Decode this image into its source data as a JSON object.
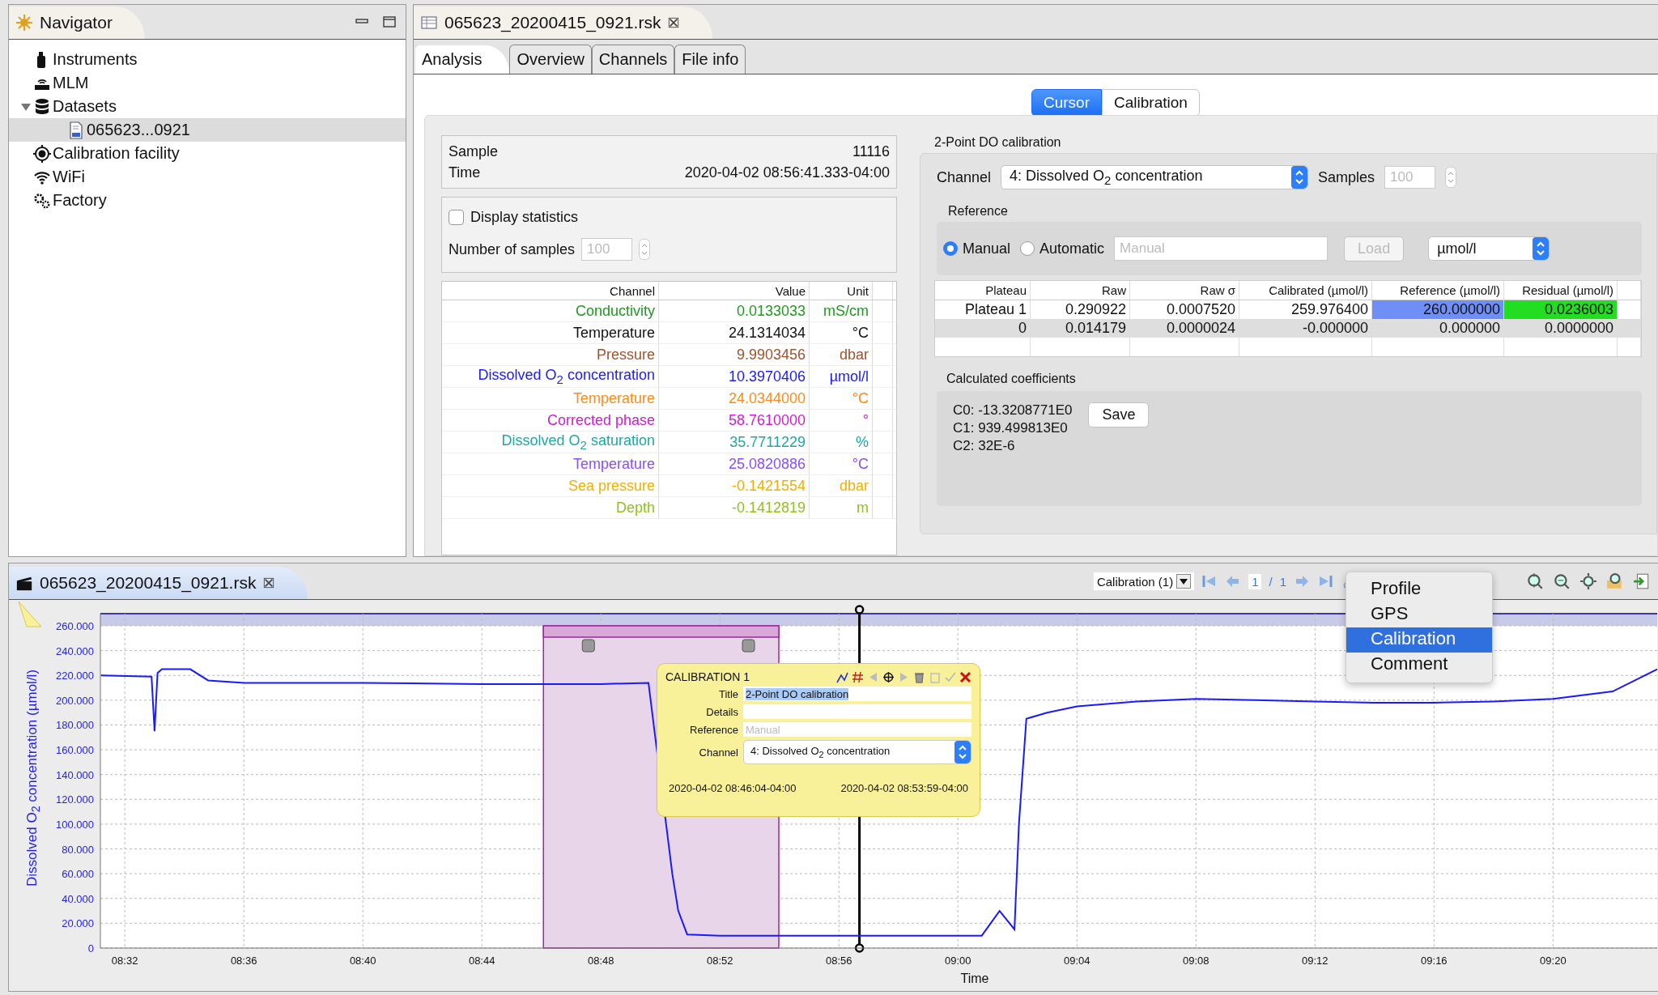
{
  "navigator": {
    "title": "Navigator",
    "items": [
      {
        "label": "Instruments",
        "kind": "instruments",
        "selected": false
      },
      {
        "label": "MLM",
        "kind": "mlm",
        "selected": false
      },
      {
        "label": "Datasets",
        "kind": "datasets",
        "selected": false,
        "expanded": true,
        "children": [
          {
            "label": "065623...0921",
            "kind": "file",
            "selected": true
          }
        ]
      },
      {
        "label": "Calibration facility",
        "kind": "facility",
        "selected": false
      },
      {
        "label": "WiFi",
        "kind": "wifi",
        "selected": false
      },
      {
        "label": "Factory",
        "kind": "factory",
        "selected": false
      }
    ]
  },
  "editor": {
    "tab": "065623_20200415_0921.rsk",
    "subtabs": [
      {
        "label": "Analysis",
        "selected": true
      },
      {
        "label": "Overview",
        "selected": false
      },
      {
        "label": "Channels",
        "selected": false
      },
      {
        "label": "File info",
        "selected": false
      }
    ],
    "modes": [
      {
        "label": "Cursor",
        "selected": true
      },
      {
        "label": "Calibration",
        "selected": false
      }
    ],
    "cursor": {
      "sample_label": "Sample",
      "sample": "11116",
      "time_label": "Time",
      "time": "2020-04-02 08:56:41.333-04:00"
    },
    "statistics": {
      "label": "Display statistics",
      "checked": false,
      "samples_label": "Number of samples",
      "samples": "100",
      "disabled": true
    },
    "channels": {
      "columns": [
        "Channel",
        "Value",
        "Unit"
      ],
      "rows": [
        {
          "name": "Conductivity",
          "value": "0.0133033",
          "unit": "mS/cm",
          "color": "#1e9a1e"
        },
        {
          "name": "Temperature",
          "value": "24.1314034",
          "unit": "°C",
          "color": "#111111"
        },
        {
          "name": "Pressure",
          "value": "9.9903456",
          "unit": "dbar",
          "color": "#a0522d"
        },
        {
          "name": "Dissolved O$_{2}$ concentration",
          "value": "10.3970406",
          "unit": "µmol/l",
          "color": "#1a1aff"
        },
        {
          "name": "Temperature",
          "value": "24.0344000",
          "unit": "°C",
          "color": "#ff8a1a"
        },
        {
          "name": "Corrected phase",
          "value": "58.7610000",
          "unit": "°",
          "color": "#d21ad2"
        },
        {
          "name": "Dissolved O$_{2}$ saturation",
          "value": "35.7711229",
          "unit": "%",
          "color": "#1fa6a6"
        },
        {
          "name": "Temperature",
          "value": "25.0820886",
          "unit": "°C",
          "color": "#8a4dff"
        },
        {
          "name": "Sea pressure",
          "value": "-0.1421554",
          "unit": "dbar",
          "color": "#f0b000"
        },
        {
          "name": "Depth",
          "value": "-0.1412819",
          "unit": "m",
          "color": "#8fc21a"
        }
      ]
    },
    "calibration": {
      "title": "2-Point DO calibration",
      "channel_label": "Channel",
      "channel": "4: Dissolved O$_{2}$ concentration",
      "samples_label": "Samples",
      "samples": "100",
      "samples_disabled": true,
      "reference_title": "Reference",
      "reference_modes": [
        {
          "label": "Manual",
          "selected": true
        },
        {
          "label": "Automatic",
          "selected": false
        }
      ],
      "reference_placeholder": "Manual",
      "load": "Load",
      "load_disabled": true,
      "unit": "µmol/l",
      "table": {
        "columns": [
          "Plateau",
          "Raw",
          "Raw σ",
          "Calibrated (µmol/l)",
          "Reference (µmol/l)",
          "Residual (µmol/l)"
        ],
        "rows": [
          {
            "selected": false,
            "cells": [
              {
                "text": "Plateau 1"
              },
              {
                "text": "0.290922"
              },
              {
                "text": "0.0007520"
              },
              {
                "text": "259.976400"
              },
              {
                "text": "260.000000",
                "color": "#6f8ff7"
              },
              {
                "text": "0.0236003",
                "color": "#22dd22"
              }
            ]
          },
          {
            "selected": true,
            "cells": [
              {
                "text": "0"
              },
              {
                "text": "0.014179"
              },
              {
                "text": "0.0000024"
              },
              {
                "text": "-0.000000"
              },
              {
                "text": "0.000000"
              },
              {
                "text": "0.0000000"
              }
            ]
          }
        ]
      },
      "coefficients_title": "Calculated coefficients",
      "coefficients": [
        "C0: -13.3208771E0",
        "C1: 939.499813E0",
        "C2: 32E-6"
      ],
      "save": "Save"
    }
  },
  "plot": {
    "tab": "065623_20200415_0921.rsk",
    "toolbar": {
      "annotation_type": "Calibration (1)",
      "page": "1",
      "separator": "/",
      "pages": "1"
    },
    "menu": [
      {
        "label": "Profile",
        "selected": false
      },
      {
        "label": "GPS",
        "selected": false
      },
      {
        "label": "Calibration",
        "selected": true
      },
      {
        "label": "Comment",
        "selected": false
      }
    ],
    "chart_data": {
      "type": "line",
      "xlabel": "Time",
      "ylabel": "Dissolved O$_{2}$ concentration (µmol/l)",
      "grid": true,
      "x": [
        511.2,
        512.9,
        513.0,
        513.1,
        513.25,
        514.2,
        514.8,
        516,
        520,
        524,
        528,
        529.6,
        530.4,
        530.6,
        530.9,
        532,
        536,
        540,
        540.8,
        541.4,
        541.9,
        542.05,
        542.3,
        543,
        544,
        546,
        548,
        550,
        552,
        554,
        556,
        558,
        560,
        562,
        563.5
      ],
      "values": [
        220,
        219,
        175,
        222,
        225,
        225,
        216,
        214,
        214,
        213,
        213,
        214,
        60,
        30,
        11,
        10,
        10,
        10,
        10,
        30,
        15,
        100,
        185,
        190,
        195,
        199,
        201,
        200,
        199,
        198,
        198,
        199,
        201,
        207,
        225
      ],
      "xlim": [
        511.18,
        563.5
      ],
      "ylim": [
        0,
        260
      ],
      "xticks": [
        {
          "value": 512,
          "label": "08:32"
        },
        {
          "value": 516,
          "label": "08:36"
        },
        {
          "value": 520,
          "label": "08:40"
        },
        {
          "value": 524,
          "label": "08:44"
        },
        {
          "value": 528,
          "label": "08:48"
        },
        {
          "value": 532,
          "label": "08:52"
        },
        {
          "value": 536,
          "label": "08:56"
        },
        {
          "value": 540,
          "label": "09:00"
        },
        {
          "value": 544,
          "label": "09:04"
        },
        {
          "value": 548,
          "label": "09:08"
        },
        {
          "value": 552,
          "label": "09:12"
        },
        {
          "value": 556,
          "label": "09:16"
        },
        {
          "value": 560,
          "label": "09:20"
        }
      ],
      "yticks": [
        {
          "value": 0,
          "label": "0"
        },
        {
          "value": 20,
          "label": "20.000"
        },
        {
          "value": 40,
          "label": "40.000"
        },
        {
          "value": 60,
          "label": "60.000"
        },
        {
          "value": 80,
          "label": "80.000"
        },
        {
          "value": 100,
          "label": "100.000"
        },
        {
          "value": 120,
          "label": "120.000"
        },
        {
          "value": 140,
          "label": "140.000"
        },
        {
          "value": 160,
          "label": "160.000"
        },
        {
          "value": 180,
          "label": "180.000"
        },
        {
          "value": 200,
          "label": "200.000"
        },
        {
          "value": 220,
          "label": "220.000"
        },
        {
          "value": 240,
          "label": "240.000"
        },
        {
          "value": 260,
          "label": "260.000"
        }
      ],
      "bands": [
        {
          "axis": "x",
          "from": 526.07,
          "to": 533.98
        }
      ],
      "ref_lines": [
        {
          "axis": "x",
          "value": 536.69
        }
      ]
    },
    "popup": {
      "title": "CALIBRATION 1",
      "fields": [
        {
          "label": "Title",
          "kind": "text",
          "value": "2-Point DO calibration"
        },
        {
          "label": "Details",
          "kind": "text"
        },
        {
          "label": "Reference",
          "kind": "text",
          "placeholder": "Manual"
        },
        {
          "label": "Channel",
          "kind": "select",
          "value": "4: Dissolved O$_{2}$ concentration"
        }
      ],
      "start": "2020-04-02 08:46:04-04:00",
      "end": "2020-04-02 08:53:59-04:00"
    }
  }
}
